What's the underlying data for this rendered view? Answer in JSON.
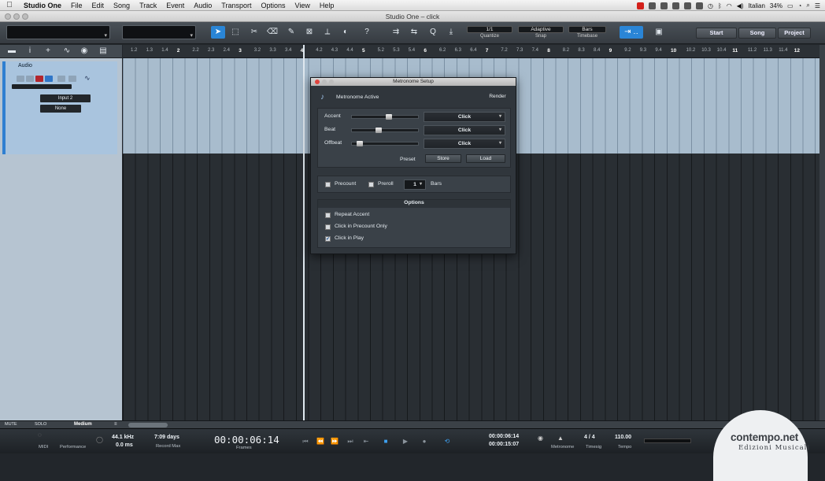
{
  "menubar": {
    "apple": "",
    "items": [
      "Studio One",
      "File",
      "Edit",
      "Song",
      "Track",
      "Event",
      "Audio",
      "Transport",
      "Options",
      "View",
      "Help"
    ],
    "tray": {
      "language": "Italian",
      "battery": "34%"
    }
  },
  "window": {
    "title": "Studio One – click"
  },
  "toolbar": {
    "quantize": {
      "value": "1/1",
      "label": "Quantize"
    },
    "snap": {
      "value": "Adaptive",
      "label": "Snap"
    },
    "timebase": {
      "value": "Bars",
      "label": "Timebase"
    },
    "nav": [
      "Start",
      "Song",
      "Project"
    ]
  },
  "track": {
    "name": "Audio",
    "input": "Input 2",
    "output": "None"
  },
  "ruler": {
    "labels": [
      "1.2",
      "1.3",
      "1.4",
      "2",
      "2.2",
      "2.3",
      "2.4",
      "3",
      "3.2",
      "3.3",
      "3.4",
      "4",
      "4.2",
      "4.3",
      "4.4",
      "5",
      "5.2",
      "5.3",
      "5.4",
      "6",
      "6.2",
      "6.3",
      "6.4",
      "7",
      "7.2",
      "7.3",
      "7.4",
      "8",
      "8.2",
      "8.3",
      "8.4",
      "9",
      "9.2",
      "9.3",
      "9.4",
      "10",
      "10.2",
      "10.3",
      "10.4",
      "11",
      "11.2",
      "11.3",
      "11.4",
      "12"
    ]
  },
  "metronome": {
    "title": "Metronome Setup",
    "active_label": "Metronome Active",
    "render": "Render",
    "rows": [
      {
        "label": "Accent",
        "sound": "Click",
        "level": 0.55
      },
      {
        "label": "Beat",
        "sound": "Click",
        "level": 0.38
      },
      {
        "label": "Offbeat",
        "sound": "Click",
        "level": 0.08
      }
    ],
    "preset_label": "Preset",
    "store": "Store",
    "load": "Load",
    "precount": "Precount",
    "preroll": "Preroll",
    "bars_value": "1",
    "bars_label": "Bars",
    "options_header": "Options",
    "options": [
      {
        "label": "Repeat Accent",
        "checked": false
      },
      {
        "label": "Click in Precount Only",
        "checked": false
      },
      {
        "label": "Click in Play",
        "checked": true
      }
    ]
  },
  "status_left": {
    "mute": "MUTE",
    "solo": "SOLO",
    "zoom": "Medium"
  },
  "transport": {
    "midi": "MIDI",
    "performance": "Performance",
    "sample_rate": "44.1 kHz",
    "latency": "0.0 ms",
    "record_days": "7:09 days",
    "record_label": "Record Max",
    "time": "00:00:06:14",
    "time_label": "Frames",
    "loop_start": "00:00:06:14",
    "loop_end": "00:00:15:07",
    "metronome_label": "Metronome",
    "timesig_value": "4 / 4",
    "timesig_label": "Timesig",
    "tempo_value": "110.00",
    "tempo_label": "Tempo"
  },
  "watermark": {
    "line1": "contempo.net",
    "line2": "Edizioni Musicali"
  }
}
